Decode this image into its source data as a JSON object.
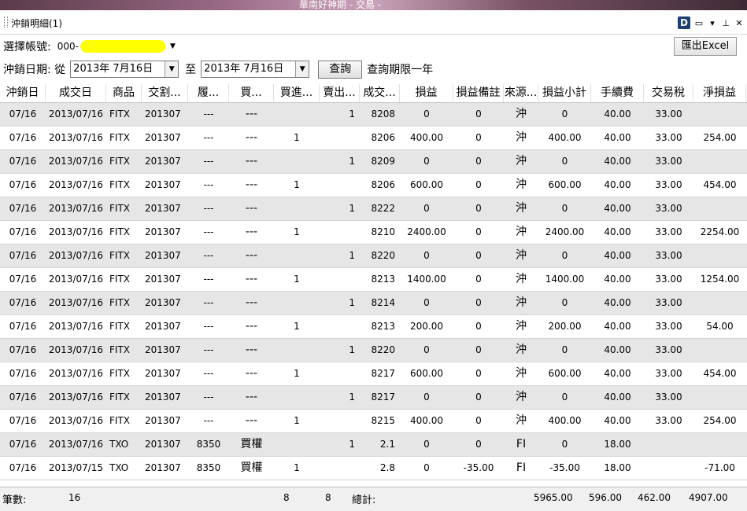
{
  "window": {
    "title": "華南好神期 - 交易 -"
  },
  "panel": {
    "title": "沖銷明細(1)"
  },
  "account": {
    "label": "選擇帳號:",
    "prefix": "000-"
  },
  "export_button": "匯出Excel",
  "date_filter": {
    "label": "沖銷日期: 從",
    "from": "2013年  7月16日",
    "to_label": "至",
    "to": "2013年  7月16日",
    "query_button": "查詢",
    "note": "查詢期限一年"
  },
  "columns": [
    "沖銷日",
    "成交日",
    "商品",
    "交割...",
    "履...",
    "買...",
    "買進...",
    "賣出...",
    "成交...",
    "損益",
    "損益備註",
    "來源...",
    "損益小計",
    "手續費",
    "交易稅",
    "淨損益"
  ],
  "rows": [
    [
      "07/16",
      "2013/07/16",
      "FITX",
      "201307",
      "---",
      "---",
      "",
      "1",
      "8208",
      "0",
      "0",
      "沖",
      "0",
      "40.00",
      "33.00",
      ""
    ],
    [
      "07/16",
      "2013/07/16",
      "FITX",
      "201307",
      "---",
      "---",
      "1",
      "",
      "8206",
      "400.00",
      "0",
      "沖",
      "400.00",
      "40.00",
      "33.00",
      "254.00"
    ],
    [
      "07/16",
      "2013/07/16",
      "FITX",
      "201307",
      "---",
      "---",
      "",
      "1",
      "8209",
      "0",
      "0",
      "沖",
      "0",
      "40.00",
      "33.00",
      ""
    ],
    [
      "07/16",
      "2013/07/16",
      "FITX",
      "201307",
      "---",
      "---",
      "1",
      "",
      "8206",
      "600.00",
      "0",
      "沖",
      "600.00",
      "40.00",
      "33.00",
      "454.00"
    ],
    [
      "07/16",
      "2013/07/16",
      "FITX",
      "201307",
      "---",
      "---",
      "",
      "1",
      "8222",
      "0",
      "0",
      "沖",
      "0",
      "40.00",
      "33.00",
      ""
    ],
    [
      "07/16",
      "2013/07/16",
      "FITX",
      "201307",
      "---",
      "---",
      "1",
      "",
      "8210",
      "2400.00",
      "0",
      "沖",
      "2400.00",
      "40.00",
      "33.00",
      "2254.00"
    ],
    [
      "07/16",
      "2013/07/16",
      "FITX",
      "201307",
      "---",
      "---",
      "",
      "1",
      "8220",
      "0",
      "0",
      "沖",
      "0",
      "40.00",
      "33.00",
      ""
    ],
    [
      "07/16",
      "2013/07/16",
      "FITX",
      "201307",
      "---",
      "---",
      "1",
      "",
      "8213",
      "1400.00",
      "0",
      "沖",
      "1400.00",
      "40.00",
      "33.00",
      "1254.00"
    ],
    [
      "07/16",
      "2013/07/16",
      "FITX",
      "201307",
      "---",
      "---",
      "",
      "1",
      "8214",
      "0",
      "0",
      "沖",
      "0",
      "40.00",
      "33.00",
      ""
    ],
    [
      "07/16",
      "2013/07/16",
      "FITX",
      "201307",
      "---",
      "---",
      "1",
      "",
      "8213",
      "200.00",
      "0",
      "沖",
      "200.00",
      "40.00",
      "33.00",
      "54.00"
    ],
    [
      "07/16",
      "2013/07/16",
      "FITX",
      "201307",
      "---",
      "---",
      "",
      "1",
      "8220",
      "0",
      "0",
      "沖",
      "0",
      "40.00",
      "33.00",
      ""
    ],
    [
      "07/16",
      "2013/07/16",
      "FITX",
      "201307",
      "---",
      "---",
      "1",
      "",
      "8217",
      "600.00",
      "0",
      "沖",
      "600.00",
      "40.00",
      "33.00",
      "454.00"
    ],
    [
      "07/16",
      "2013/07/16",
      "FITX",
      "201307",
      "---",
      "---",
      "",
      "1",
      "8217",
      "0",
      "0",
      "沖",
      "0",
      "40.00",
      "33.00",
      ""
    ],
    [
      "07/16",
      "2013/07/16",
      "FITX",
      "201307",
      "---",
      "---",
      "1",
      "",
      "8215",
      "400.00",
      "0",
      "沖",
      "400.00",
      "40.00",
      "33.00",
      "254.00"
    ],
    [
      "07/16",
      "2013/07/16",
      "TXO",
      "201307",
      "8350",
      "買權",
      "",
      "1",
      "2.1",
      "0",
      "0",
      "FI",
      "0",
      "18.00",
      "",
      ""
    ],
    [
      "07/16",
      "2013/07/15",
      "TXO",
      "201307",
      "8350",
      "買權",
      "1",
      "",
      "2.8",
      "0",
      "-35.00",
      "FI",
      "-35.00",
      "18.00",
      "",
      "-71.00"
    ]
  ],
  "footer": {
    "count_label": "筆數:",
    "count": "16",
    "buy_total": "8",
    "sell_total": "8",
    "total_label": "總計:",
    "pnl_subtotal": "5965.00",
    "fee": "596.00",
    "tax": "462.00",
    "net": "4907.00"
  }
}
